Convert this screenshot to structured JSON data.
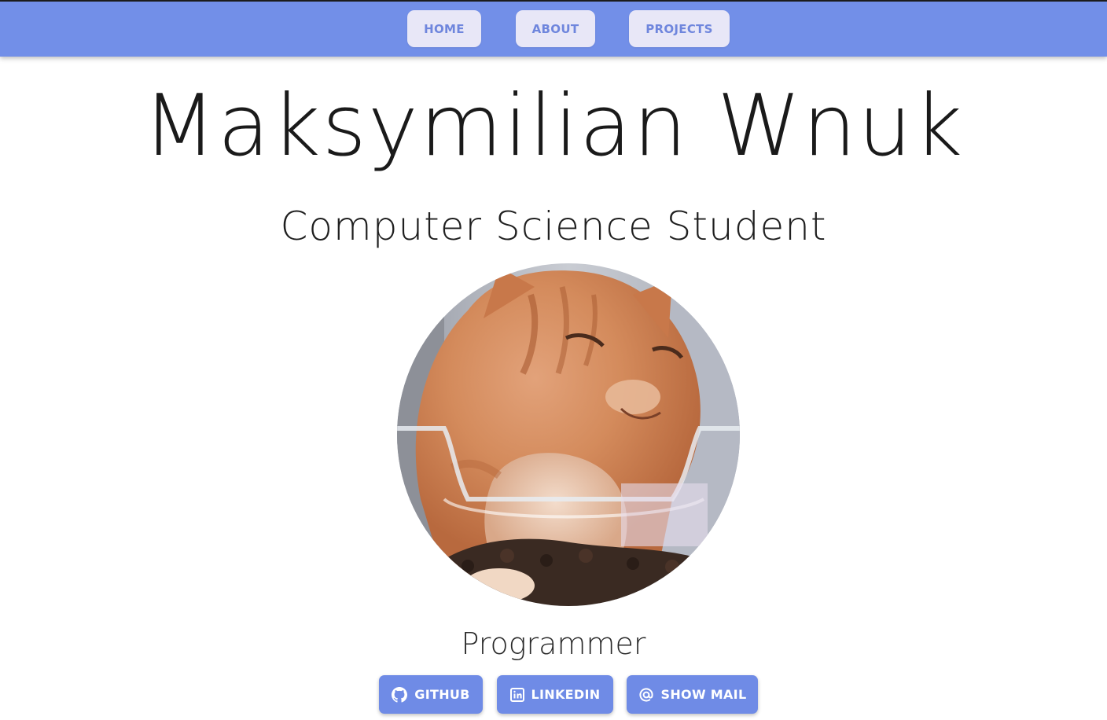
{
  "nav": {
    "home": "HOME",
    "about": "ABOUT",
    "projects": "PROJECTS"
  },
  "hero": {
    "name": "Maksymilian Wnuk",
    "subtitle": "Computer Science Student",
    "role": "Programmer"
  },
  "social": {
    "github": "GITHUB",
    "linkedin": "LINKEDIN",
    "mail": "SHOW MAIL"
  },
  "icons": {
    "github": "github-icon",
    "linkedin": "linkedin-icon",
    "mail": "at-sign-icon"
  },
  "colors": {
    "navbar": "#728fe8",
    "nav_button_bg": "#e8e7f7",
    "nav_button_text": "#6f86dd",
    "social_button_bg": "#6f8be6"
  }
}
